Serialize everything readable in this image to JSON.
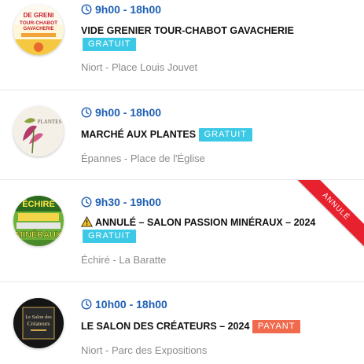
{
  "events": [
    {
      "time": "9h00 - 18h00",
      "title": "VIDE GRENIER TOUR-CHABOT GAVACHERIE",
      "price_badge": "GRATUIT",
      "location": "Niort - Place Louis Jouvet",
      "thumb": {
        "line1": "DE GRENI",
        "line2": "TOUR-CHABOT",
        "line3": "GAVACHERIE"
      }
    },
    {
      "time": "9h00 - 18h00",
      "title": "MARCHÉ AUX PLANTES",
      "price_badge": "GRATUIT",
      "location": "Épannes - Place de l'Église",
      "thumb": {
        "line1": "PLANTES"
      }
    },
    {
      "time": "9h30 - 19h00",
      "title": "ANNULÉ – SALON PASSION MINÉRAUX – 2024",
      "price_badge": "GRATUIT",
      "location": "Échiré - La Baratte",
      "ribbon": "ANNULÉ",
      "thumb": {
        "line1": "ÉCHIRÉ",
        "line2": "MINÉRAUX"
      }
    },
    {
      "time": "10h00 - 18h00",
      "title": "LE SALON DES CRÉATEURS – 2024",
      "price_badge": "PAYANT",
      "location": "Niort - Parc des Expositions",
      "thumb": {
        "line1": "Le Salon des",
        "line2": "Créateurs"
      }
    }
  ],
  "colors": {
    "time": "#1e5fb4",
    "free_badge": "#3cc9e6",
    "paid_badge": "#f06a4e",
    "ribbon": "#e8212e",
    "location": "#8b8b8b"
  },
  "icons": {
    "time": "clock-icon",
    "warning": "warning-icon"
  }
}
